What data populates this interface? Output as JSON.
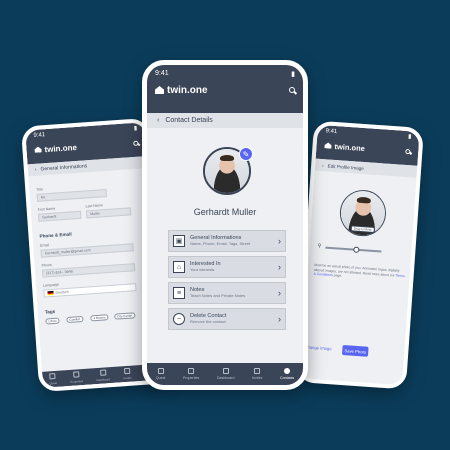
{
  "colors": {
    "background": "#0b3d5b",
    "header": "#3b4558",
    "accent": "#5865f2"
  },
  "brand": "twin.one",
  "center": {
    "time": "9:41",
    "back_label": "Contact Details",
    "name": "Gerhardt Muller",
    "menu": [
      {
        "title": "General Informations",
        "subtitle": "Name, Phone, Email, Tags, Street",
        "icon": "id-card-icon"
      },
      {
        "title": "Interested In",
        "subtitle": "Your interests",
        "icon": "house-icon"
      },
      {
        "title": "Notes",
        "subtitle": "Teach Notes and Private Notes",
        "icon": "notes-icon"
      },
      {
        "title": "Delete Contact",
        "subtitle": "Remove the contact",
        "icon": "minus-circle-icon"
      }
    ],
    "tabs": [
      "Quest",
      "Properties",
      "Dashboard",
      "Invites",
      "Contacts"
    ],
    "active_tab": 4
  },
  "left": {
    "time": "9:41",
    "back_label": "General Informations",
    "title_label": "Title",
    "title_value": "Mr.",
    "first_name_label": "First Name",
    "first_name_value": "Gerhardt",
    "last_name_label": "Last Name",
    "last_name_value": "Muller",
    "phone_email_heading": "Phone & Email",
    "email_label": "Email",
    "email_value": "Gerhardt_muller@gmail.com",
    "phone_label": "Phone",
    "phone_value": "(317) 624 - 9948",
    "language_label": "Language",
    "language_value": "Deutsch",
    "tags_heading": "Tags",
    "tags": [
      "Lift Ac",
      "Comfort",
      "4 Rooms",
      "City Center"
    ],
    "tabs": [
      "Quest",
      "Properties",
      "Dashboard",
      "Invites",
      "Contacts"
    ]
  },
  "right": {
    "time": "9:41",
    "back_label": "Edit Profile Image",
    "photo_tag": "Drag to Move",
    "hint_text": "Must be an actual photo of you. Animated, logos, digitally altered images, are not allowed. Read more about our",
    "hint_link": "Terms & Conditions",
    "hint_end": "page.",
    "change_label": "Change image",
    "save_label": "Save Photo",
    "zoom_level": 0.55
  }
}
